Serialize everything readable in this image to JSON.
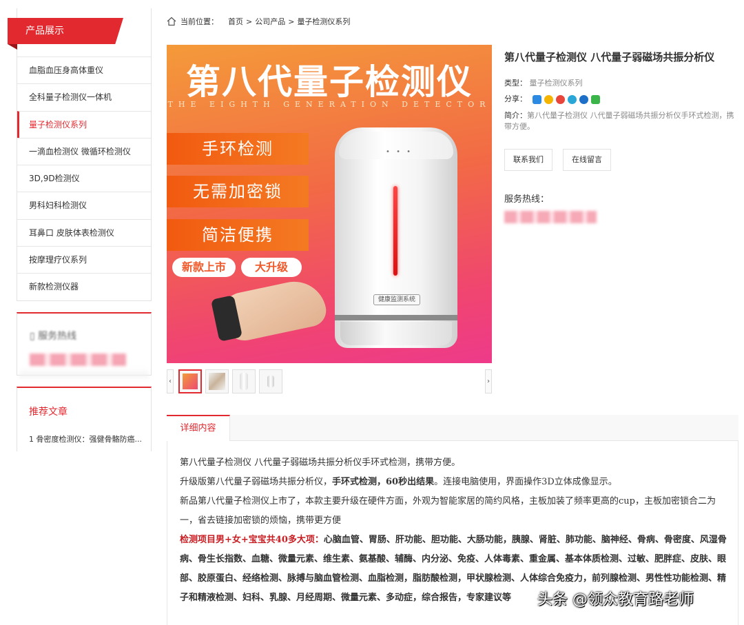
{
  "sidebar": {
    "category_title": "产品展示",
    "items": [
      {
        "label": "血脂血压身高体重仪"
      },
      {
        "label": "全科量子检测仪一体机"
      },
      {
        "label": "量子检测仪系列",
        "active": true
      },
      {
        "label": "一滴血检测仪 微循环检测仪"
      },
      {
        "label": "3D,9D检测仪"
      },
      {
        "label": "男科妇科检测仪"
      },
      {
        "label": "耳鼻口 皮肤体表检测仪"
      },
      {
        "label": "按摩理疗仪系列"
      },
      {
        "label": "新款检测仪器"
      }
    ],
    "hotline_title": "服务热线",
    "articles_title": "推荐文章",
    "articles": [
      {
        "label": "1 骨密度检测仪：强健骨骼防癌..."
      }
    ]
  },
  "breadcrumb": {
    "prefix": "当前位置：",
    "home": "首页",
    "sep": ">",
    "level1": "公司产品",
    "level2": "量子检测仪系列"
  },
  "product_image": {
    "title": "第八代量子检测仪",
    "subtitle": "THE EIGHTH GENERATION DETECTOR",
    "tags": [
      "手环检测",
      "无需加密锁",
      "简洁便携"
    ],
    "pills": [
      "新款上市",
      "大升级"
    ],
    "device_label": "健康监测系统",
    "device_dots": "• • •"
  },
  "thumbs": {
    "prev": "‹",
    "next": "›",
    "count": 4
  },
  "info": {
    "title": "第八代量子检测仪 八代量子弱磁场共振分析仪",
    "type_label": "类型：",
    "type_value": "量子检测仪系列",
    "share_label": "分享：",
    "share_icons": [
      "qzone-icon",
      "star-icon",
      "weibo-icon",
      "pinterest-icon",
      "renren-icon",
      "wechat-icon"
    ],
    "desc_label": "简介：",
    "desc_value": "第八代量子检测仪 八代量子弱磁场共振分析仪手环式检测，携带方便。",
    "contact_button": "联系我们",
    "message_button": "在线留言",
    "hotline_label": "服务热线："
  },
  "detail": {
    "tab_label": "详细内容",
    "p1": "第八代量子检测仪  八代量子弱磁场共振分析仪手环式检测，携带方便。",
    "p2a": "升级版第八代量子弱磁场共振分析仪，",
    "p2b": "手环式检测，60秒出结果",
    "p2c": "。连接电脑使用，界面操作3D立体成像显示。",
    "p3": "新品第八代量子检测仪上市了，本款主要升级在硬件方面，外观为智能家居的简约风格，主板加装了频率更高的cup，主板加密锁合二为一，省去链接加密锁的烦恼，携带更方便",
    "p4_red": "检测项目男+女+宝宝共40多大项：",
    "p4": "心脑血管、胃肠、肝功能、胆功能、大肠功能，胰腺、肾脏、肺功能、脑神经、骨病、骨密度、风湿骨病、骨生长指数、血糖、微量元素、维生素、氨基酸、辅酶、内分泌、免疫、人体毒素、重金属、基本体质检测、过敏、肥胖症、皮肤、眼部、胶原蛋白、经络检测、脉搏与脑血管检测、血脂检测，脂肪酸检测，甲状腺检测、人体综合免疫力，前列腺检测、男性性功能检测、精子和精液检测、妇科、乳腺、月经周期、微量元素、多动症，综合报告，专家建议等"
  },
  "watermark": "头条 @领众教育路老师",
  "colors": {
    "accent": "#e1292f"
  }
}
